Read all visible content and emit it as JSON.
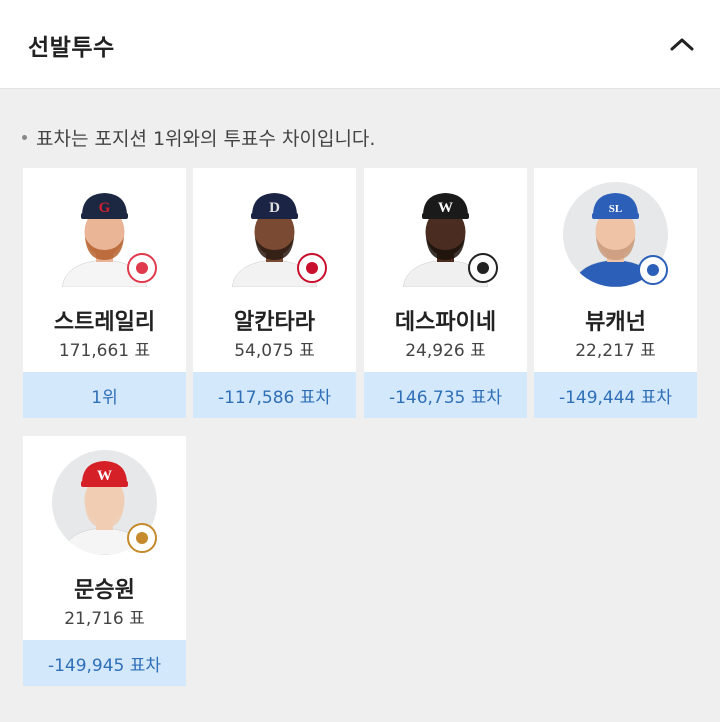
{
  "header": {
    "title": "선발투수"
  },
  "note": "표차는 포지션 1위와의 투표수 차이입니다.",
  "players": [
    {
      "name": "스트레일리",
      "votes": "171,661 표",
      "diff": "1위",
      "team": "lotte-giants-logo",
      "cap_color": "#1c2841",
      "cap_letter": "G",
      "letter_color": "#d0202e",
      "logo_color": "#e03a4e",
      "skin": "#e9b596",
      "beard": "#b5602e",
      "shirt": "#f5f5f5"
    },
    {
      "name": "알칸타라",
      "votes": "54,075 표",
      "diff": "-117,586 표차",
      "team": "doosan-bears-logo",
      "cap_color": "#1b2444",
      "cap_letter": "D",
      "letter_color": "#e0e0e0",
      "logo_color": "#c8102e",
      "skin": "#7a4a32",
      "beard": "#2a1a12",
      "shirt": "#f2f2f2"
    },
    {
      "name": "데스파이네",
      "votes": "24,926 표",
      "diff": "-146,735 표차",
      "team": "kt-wiz-logo",
      "cap_color": "#1a1a1a",
      "cap_letter": "W",
      "letter_color": "#ffffff",
      "logo_color": "#222222",
      "skin": "#4a2c20",
      "beard": "#1a120c",
      "shirt": "#f0f0f0"
    },
    {
      "name": "뷰캐넌",
      "votes": "22,217 표",
      "diff": "-149,444 표차",
      "team": "samsung-lions-logo",
      "cap_color": "#2c5fb8",
      "cap_letter": "SL",
      "letter_color": "#ffffff",
      "logo_color": "#2c5fb8",
      "skin": "#eec3a6",
      "beard": "#c99a7a",
      "shirt": "#2c5fb8"
    },
    {
      "name": "문승원",
      "votes": "21,716 표",
      "diff": "-149,945 표차",
      "team": "sk-wyverns-logo",
      "cap_color": "#d62027",
      "cap_letter": "W",
      "letter_color": "#ffffff",
      "logo_color": "#c48a2b",
      "skin": "#f0cdb3",
      "beard": "#f0cdb3",
      "shirt": "#f5f5f5"
    }
  ]
}
